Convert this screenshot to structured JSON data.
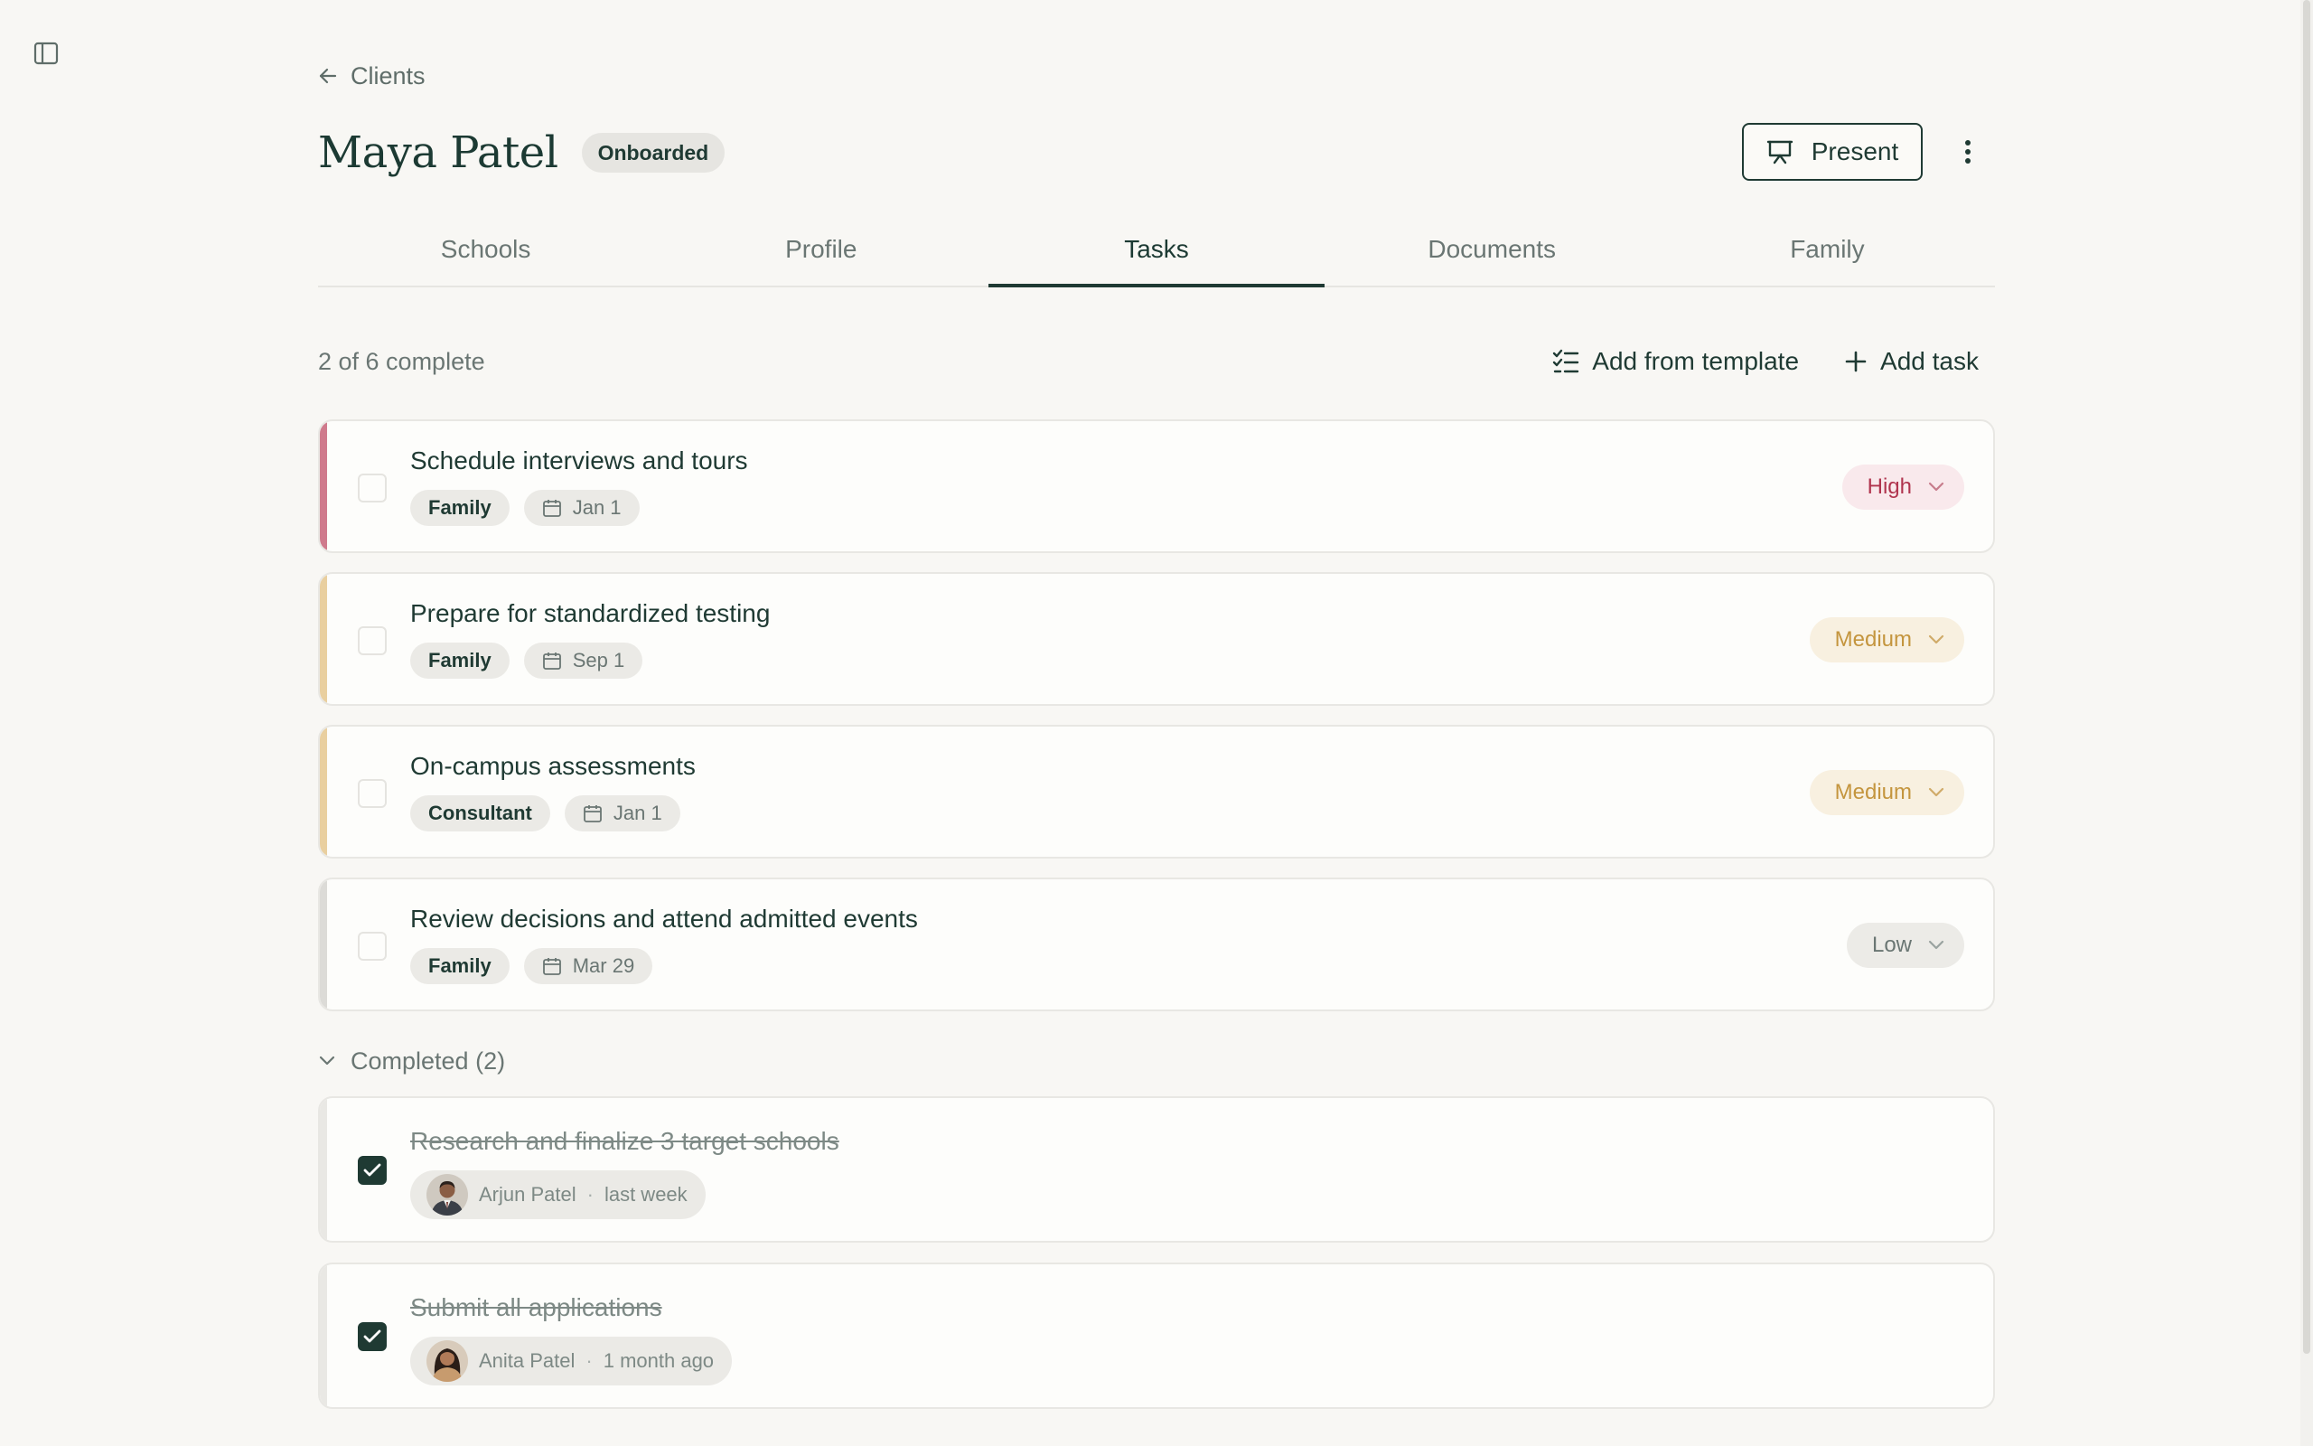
{
  "nav": {
    "back_label": "Clients"
  },
  "header": {
    "title": "Maya Patel",
    "status": "Onboarded",
    "present_label": "Present"
  },
  "tabs": [
    {
      "label": "Schools",
      "active": false
    },
    {
      "label": "Profile",
      "active": false
    },
    {
      "label": "Tasks",
      "active": true
    },
    {
      "label": "Documents",
      "active": false
    },
    {
      "label": "Family",
      "active": false
    }
  ],
  "tasks_bar": {
    "progress": "2 of 6 complete",
    "add_template_label": "Add from template",
    "add_task_label": "Add task"
  },
  "tasks": [
    {
      "title": "Schedule interviews and tours",
      "owner": "Family",
      "date": "Jan 1",
      "priority": "High"
    },
    {
      "title": "Prepare for standardized testing",
      "owner": "Family",
      "date": "Sep 1",
      "priority": "Medium"
    },
    {
      "title": "On-campus assessments",
      "owner": "Consultant",
      "date": "Jan 1",
      "priority": "Medium"
    },
    {
      "title": "Review decisions and attend admitted events",
      "owner": "Family",
      "date": "Mar 29",
      "priority": "Low"
    }
  ],
  "completed": {
    "label": "Completed (2)",
    "items": [
      {
        "title": "Research and finalize 3 target schools",
        "person": "Arjun Patel",
        "when": "last week",
        "separator": "·"
      },
      {
        "title": "Submit all applications",
        "person": "Anita Patel",
        "when": "1 month ago",
        "separator": "·"
      }
    ]
  },
  "colors": {
    "accent": "#1f3a33",
    "high_text": "#b0344e",
    "high_bg": "#f9e9ec",
    "high_bar": "#cf7a8c",
    "medium_text": "#c4953e",
    "medium_bg": "#f8f0e0",
    "medium_bar": "#e9cf9f",
    "low_text": "#6a7673",
    "low_bg": "#ecebe7",
    "low_bar": "#dcdbd7"
  }
}
